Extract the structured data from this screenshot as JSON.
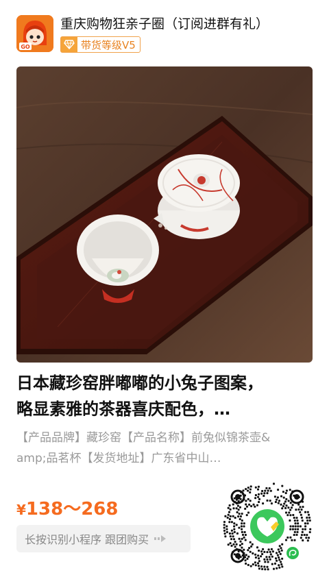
{
  "header": {
    "shop_name": "重庆购物狂亲子圈（订阅进群有礼）",
    "level_badge": "带货等级V5",
    "avatar_text": "GO"
  },
  "product": {
    "title_line1": "日本藏珍窑胖嘟嘟的小兔子图案，",
    "title_line2": "略显素雅的茶器喜庆配色，…",
    "desc_line1": "【产品品牌】藏珍窑【产品名称】前兔似锦茶壶&",
    "desc_line2": "amp;品茗杯【发货地址】广东省中山…",
    "currency": "¥",
    "price_range": "138～268"
  },
  "cta": {
    "label": "长按识别小程序 跟团购买"
  },
  "colors": {
    "accent": "#f56b1f",
    "badge": "#f0a14a",
    "qr_center": "#3cc85c"
  }
}
